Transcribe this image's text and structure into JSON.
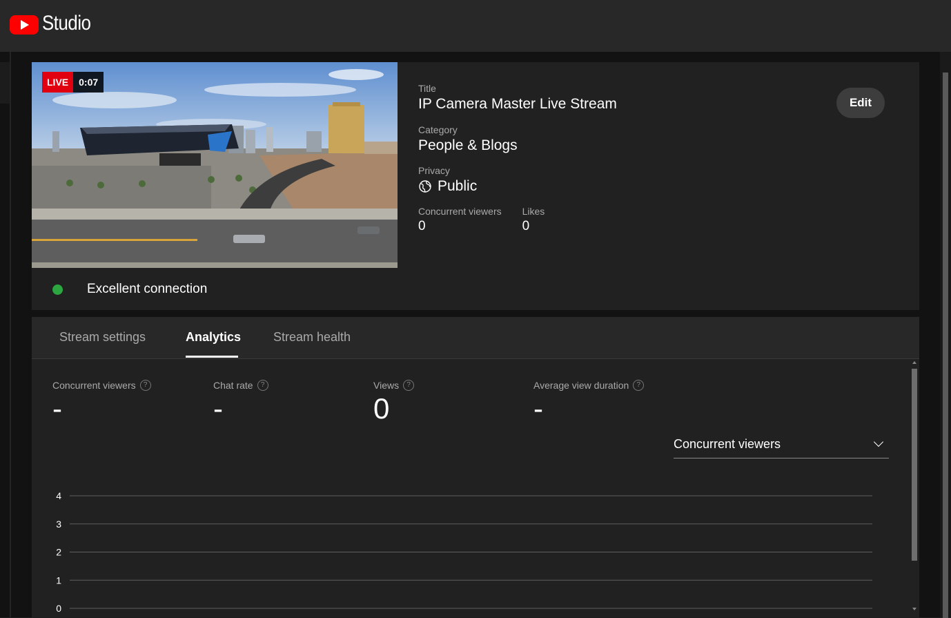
{
  "app": {
    "logo_text": "Studio"
  },
  "stream": {
    "live_label": "LIVE",
    "elapsed": "0:07",
    "connection_status": "Excellent connection",
    "connection_color": "#2ba640"
  },
  "meta": {
    "title_label": "Title",
    "title": "IP Camera Master Live Stream",
    "category_label": "Category",
    "category": "People & Blogs",
    "privacy_label": "Privacy",
    "privacy": "Public",
    "privacy_icon": "globe-icon",
    "concurrent_label": "Concurrent viewers",
    "concurrent_value": "0",
    "likes_label": "Likes",
    "likes_value": "0",
    "edit_label": "Edit"
  },
  "tabs": [
    {
      "label": "Stream settings",
      "active": false
    },
    {
      "label": "Analytics",
      "active": true
    },
    {
      "label": "Stream health",
      "active": false
    }
  ],
  "stats": [
    {
      "label": "Concurrent viewers",
      "value": "-"
    },
    {
      "label": "Chat rate",
      "value": "-"
    },
    {
      "label": "Views",
      "value": "0"
    },
    {
      "label": "Average view duration",
      "value": "-"
    }
  ],
  "help_icon_glyph": "?",
  "metric_selector": {
    "selected": "Concurrent viewers"
  },
  "colors": {
    "live_red": "#e0000f",
    "brand_red": "#ff0000"
  },
  "chart_data": {
    "type": "line",
    "title": "",
    "xlabel": "",
    "ylabel": "",
    "ylim": [
      0,
      4
    ],
    "y_ticks": [
      "4",
      "3",
      "2",
      "1",
      "0"
    ],
    "grid": true,
    "series": []
  }
}
